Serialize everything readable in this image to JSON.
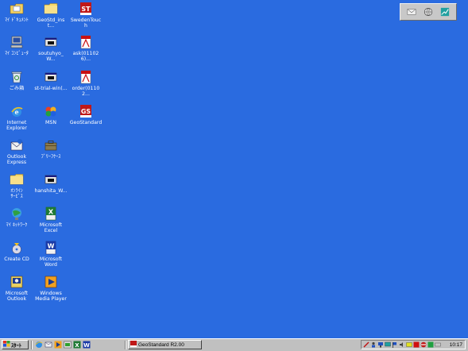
{
  "desktop": {
    "icons": [
      {
        "label": "ﾏｲ ﾄﾞｷｭﾒﾝﾄ",
        "icon": "my-documents-icon"
      },
      {
        "label": "GeoStd_inst...",
        "icon": "folder-icon"
      },
      {
        "label": "SwedenTouch",
        "icon": "st-app-icon"
      },
      {
        "label": "ﾏｲ ｺﾝﾋﾟｭｰﾀ",
        "icon": "my-computer-icon"
      },
      {
        "label": "soutuhyo_W...",
        "icon": "application-icon"
      },
      {
        "label": "ask(011026)...",
        "icon": "pdf-icon"
      },
      {
        "label": "ごみ箱",
        "icon": "recycle-bin-icon"
      },
      {
        "label": "st-trial-win(...",
        "icon": "application-icon"
      },
      {
        "label": "order(01102...",
        "icon": "pdf-icon"
      },
      {
        "label": "Internet\nExplorer",
        "icon": "internet-explorer-icon"
      },
      {
        "label": "MSN",
        "icon": "msn-icon"
      },
      {
        "label": "GeoStandard",
        "icon": "gs-app-icon"
      },
      {
        "label": "Outlook\nExpress",
        "icon": "outlook-express-icon"
      },
      {
        "label": "ﾌﾞﾘｰﾌｹｰｽ",
        "icon": "briefcase-icon"
      },
      {
        "label": "ｵﾝﾗｲﾝ\nｻｰﾋﾞｽ",
        "icon": "folder-icon"
      },
      {
        "label": "hanshita_W...",
        "icon": "application-icon"
      },
      {
        "label": "ﾏｲ ﾈｯﾄﾜｰｸ",
        "icon": "network-icon"
      },
      {
        "label": "Microsoft\nExcel",
        "icon": "excel-icon"
      },
      {
        "label": "Create CD",
        "icon": "create-cd-icon"
      },
      {
        "label": "Microsoft\nWord",
        "icon": "word-icon"
      },
      {
        "label": "Microsoft\nOutlook",
        "icon": "outlook-icon"
      },
      {
        "label": "Windows\nMedia Player",
        "icon": "media-player-icon"
      }
    ]
  },
  "taskbar": {
    "start_label": "ｽﾀｰﾄ",
    "task_label": "GeoStandard R2.00",
    "clock": "10:17"
  },
  "colors": {
    "desktop_background": "#2a6be0",
    "taskbar_background": "#c0c0c0"
  }
}
